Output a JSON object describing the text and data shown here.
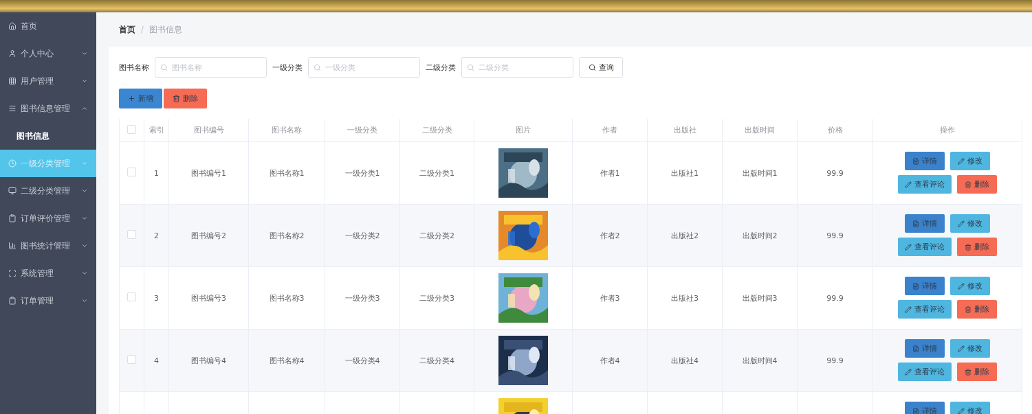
{
  "sidebar": {
    "items": [
      {
        "label": "首页",
        "selected": false
      },
      {
        "label": "个人中心",
        "selected": false,
        "expanded": false
      },
      {
        "label": "用户管理",
        "selected": false,
        "expanded": false
      },
      {
        "label": "图书信息管理",
        "selected": false,
        "expanded": true,
        "children": [
          {
            "label": "图书信息",
            "selected": true
          }
        ]
      },
      {
        "label": "一级分类管理",
        "selected": false,
        "hovered": true,
        "expanded": false
      },
      {
        "label": "二级分类管理",
        "selected": false,
        "expanded": false
      },
      {
        "label": "订单评价管理",
        "selected": false,
        "expanded": false
      },
      {
        "label": "图书统计管理",
        "selected": false,
        "expanded": false
      },
      {
        "label": "系统管理",
        "selected": false,
        "expanded": false
      },
      {
        "label": "订单管理",
        "selected": false,
        "expanded": false
      }
    ]
  },
  "breadcrumb": {
    "items": [
      "首页",
      "图书信息"
    ],
    "separator": "/"
  },
  "filters": [
    {
      "label": "图书名称",
      "placeholder": "图书名称"
    },
    {
      "label": "一级分类",
      "placeholder": "一级分类"
    },
    {
      "label": "二级分类",
      "placeholder": "二级分类"
    }
  ],
  "search_button": "查询",
  "toolbar": [
    {
      "label": "新增",
      "kind": "add"
    },
    {
      "label": "删除",
      "kind": "delete"
    }
  ],
  "table": {
    "select_all": {
      "checked": false
    },
    "columns": [
      "索引",
      "图书编号",
      "图书名称",
      "一级分类",
      "二级分类",
      "图片",
      "作者",
      "出版社",
      "出版时间",
      "价格",
      "操作"
    ],
    "rows": [
      {
        "checked": false,
        "cells": [
          "1",
          "图书编号1",
          "图书名称1",
          "一级分类1",
          "二级分类1",
          null,
          "作者1",
          "出版社1",
          "出版时间1",
          "99.9"
        ],
        "image": {
          "kind": "picture"
        },
        "actions": [
          {
            "label": "详情",
            "kind": "detail"
          },
          {
            "label": "修改",
            "kind": "edit"
          },
          {
            "label": "查看评论",
            "kind": "comments"
          },
          {
            "label": "删除",
            "kind": "delete"
          }
        ]
      },
      {
        "checked": false,
        "cells": [
          "2",
          "图书编号2",
          "图书名称2",
          "一级分类2",
          "二级分类2",
          null,
          "作者2",
          "出版社2",
          "出版时间2",
          "99.9"
        ],
        "image": {
          "kind": "picture"
        },
        "actions": [
          {
            "label": "详情",
            "kind": "detail"
          },
          {
            "label": "修改",
            "kind": "edit"
          },
          {
            "label": "查看评论",
            "kind": "comments"
          },
          {
            "label": "删除",
            "kind": "delete"
          }
        ]
      },
      {
        "checked": false,
        "cells": [
          "3",
          "图书编号3",
          "图书名称3",
          "一级分类3",
          "二级分类3",
          null,
          "作者3",
          "出版社3",
          "出版时间3",
          "99.9"
        ],
        "image": {
          "kind": "picture"
        },
        "actions": [
          {
            "label": "详情",
            "kind": "detail"
          },
          {
            "label": "修改",
            "kind": "edit"
          },
          {
            "label": "查看评论",
            "kind": "comments"
          },
          {
            "label": "删除",
            "kind": "delete"
          }
        ]
      },
      {
        "checked": false,
        "cells": [
          "4",
          "图书编号4",
          "图书名称4",
          "一级分类4",
          "二级分类4",
          null,
          "作者4",
          "出版社4",
          "出版时间4",
          "99.9"
        ],
        "image": {
          "kind": "picture"
        },
        "actions": [
          {
            "label": "详情",
            "kind": "detail"
          },
          {
            "label": "修改",
            "kind": "edit"
          },
          {
            "label": "查看评论",
            "kind": "comments"
          },
          {
            "label": "删除",
            "kind": "delete"
          }
        ]
      },
      {
        "cells": [],
        "image": {
          "kind": "picture"
        },
        "actions": [
          {
            "label": "详情",
            "kind": "detail"
          },
          {
            "label": "修改",
            "kind": "edit"
          }
        ]
      }
    ]
  }
}
